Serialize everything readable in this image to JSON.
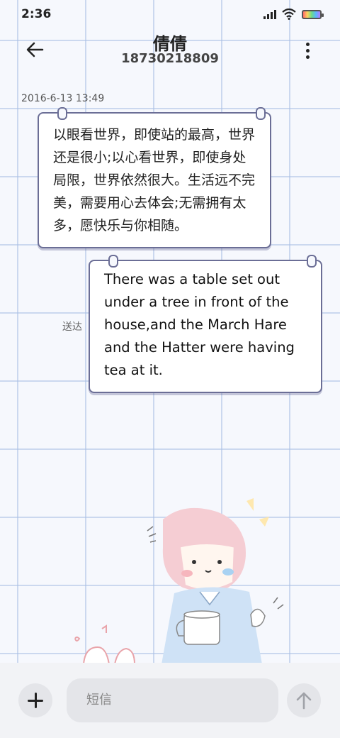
{
  "status_bar": {
    "time": "2:36"
  },
  "header": {
    "contact_name": "倩倩",
    "contact_number": "18730218809"
  },
  "conversation": {
    "timestamp": "2016-6-13 13:49",
    "messages": [
      {
        "direction": "incoming",
        "text": "以眼看世界，即使站的最高，世界还是很小;以心看世界，即使身处局限，世界依然很大。生活远不完美，需要用心去体会;无需拥有太多，愿快乐与你相随。"
      },
      {
        "direction": "outgoing",
        "text": "There was a table set out under a tree in front of the house,and the March Hare and the Hatter were having tea at it.",
        "status": "送达"
      }
    ]
  },
  "composer": {
    "placeholder": "短信"
  },
  "icons": {
    "back": "arrow-left-icon",
    "more": "more-vertical-icon",
    "add": "plus-icon",
    "send": "arrow-up-icon",
    "signal": "signal-icon",
    "wifi": "wifi-icon",
    "battery": "battery-icon"
  },
  "colors": {
    "bubble_border": "#6b6e96",
    "grid_line": "#a8bee4",
    "background": "#f6f8fd"
  }
}
